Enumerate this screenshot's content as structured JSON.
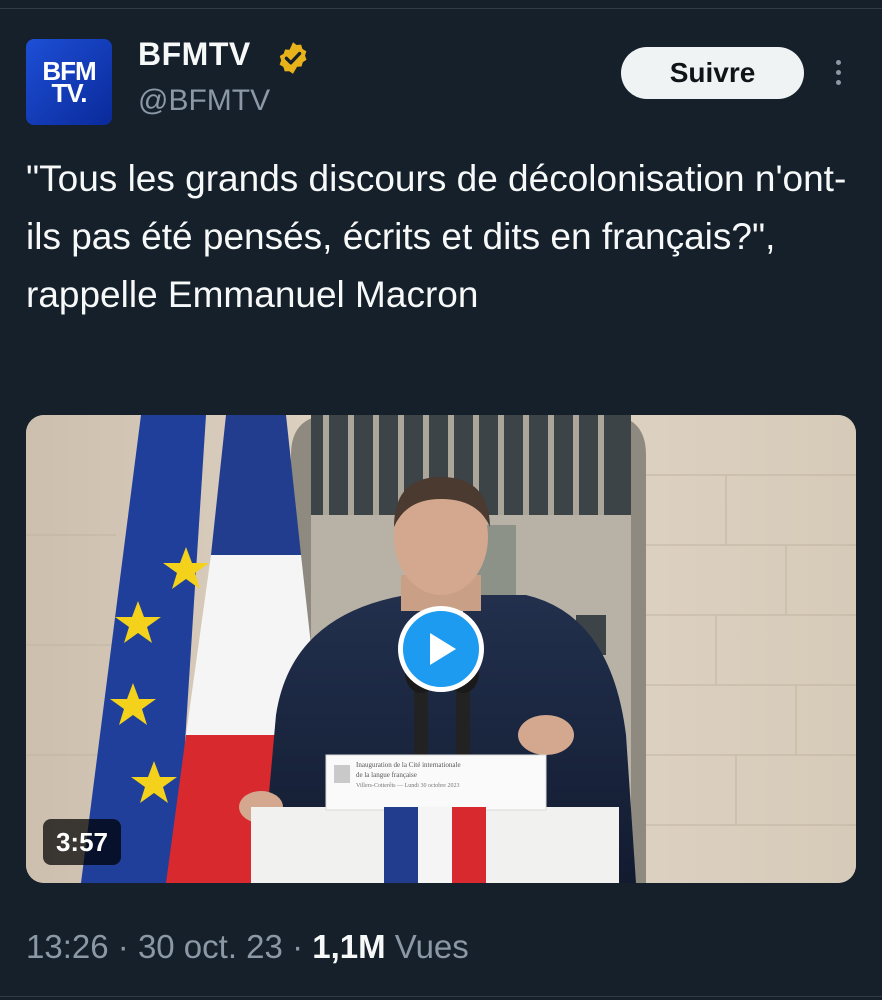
{
  "account": {
    "logo_line1": "BFM",
    "logo_line2": "TV.",
    "name": "BFMTV",
    "handle": "@BFMTV",
    "verified_badge": "verified-gold-icon"
  },
  "actions": {
    "follow_label": "Suivre",
    "more_icon": "more-vertical-icon"
  },
  "tweet": {
    "text": "\"Tous les grands discours de décolonisation n'ont-ils pas été pensés, écrits et dits en français?\", rappelle Emmanuel Macron"
  },
  "media": {
    "type": "video",
    "duration": "3:57",
    "play_icon": "play-icon",
    "lectern_text_1": "Inauguration de la Cité internationale",
    "lectern_text_2": "de la langue française",
    "lectern_text_3": "Villers-Cotterêts — Lundi 30 octobre 2023"
  },
  "meta": {
    "time": "13:26",
    "separator": "·",
    "date": "30 oct. 23",
    "views_count": "1,1M",
    "views_label": "Vues"
  },
  "colors": {
    "background": "#15202b",
    "text": "#f7f9f9",
    "muted": "#8b98a5",
    "accent": "#1d9bf0",
    "verified": "#e8b31a"
  }
}
